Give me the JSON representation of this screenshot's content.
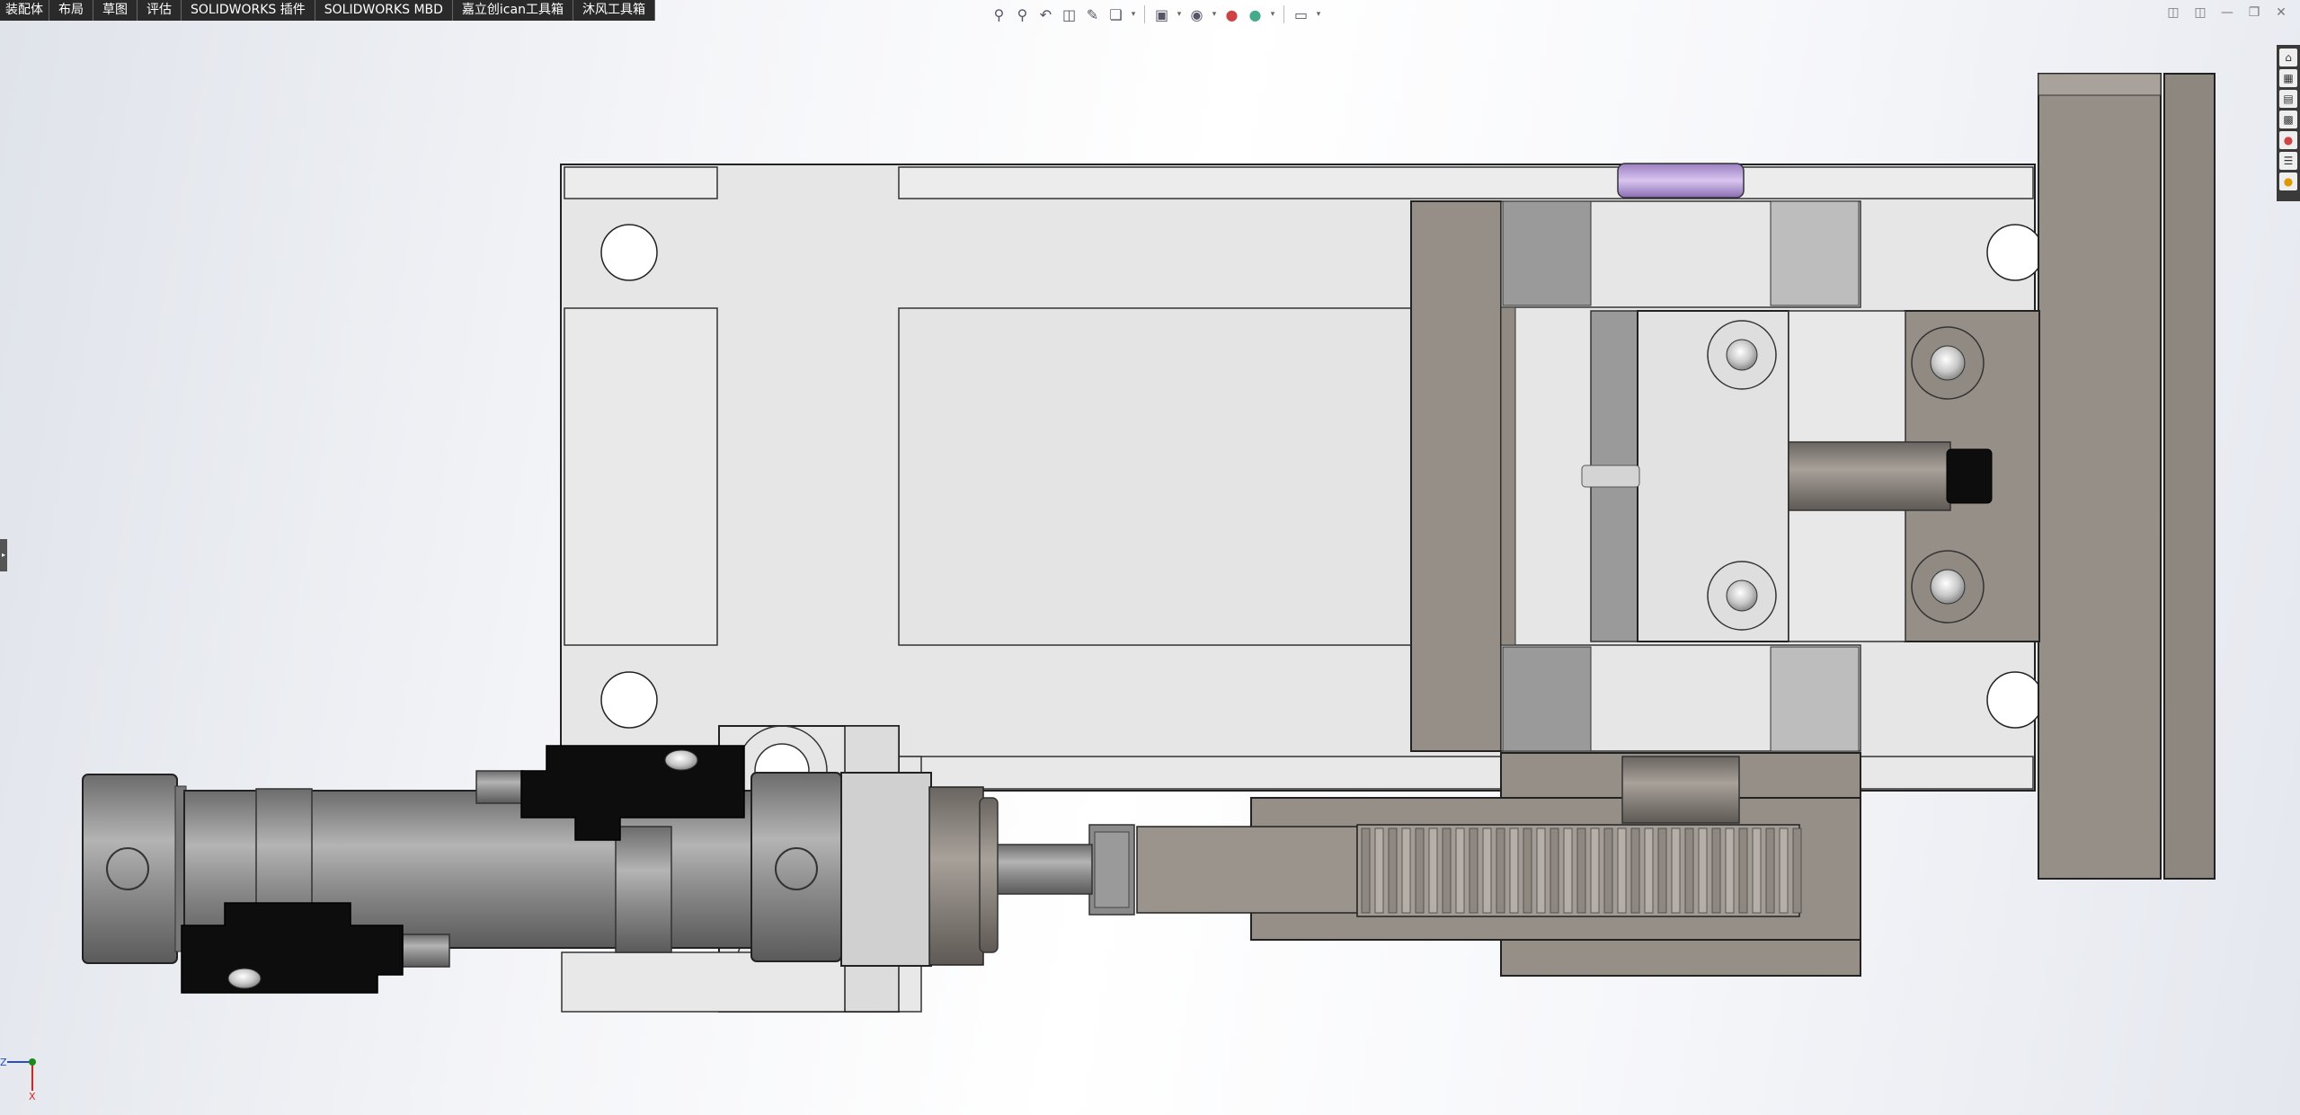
{
  "ribbon_tabs": [
    "装配体",
    "布局",
    "草图",
    "评估",
    "SOLIDWORKS 插件",
    "SOLIDWORKS MBD",
    "嘉立创ican工具箱",
    "沐风工具箱"
  ],
  "headsup_icons": [
    "zoom-to-fit-icon",
    "zoom-to-area-icon",
    "previous-view-icon",
    "section-view-icon",
    "dynamic-annotation-icon",
    "view-orientation-icon",
    "display-style-icon",
    "hide-show-items-icon",
    "edit-appearance-icon",
    "apply-scene-icon",
    "view-settings-icon"
  ],
  "window_controls": [
    "tile-left-icon",
    "tile-right-icon",
    "minimize-icon",
    "restore-icon",
    "close-icon"
  ],
  "task_pane_icons": [
    "solidworks-resources-icon",
    "design-library-icon",
    "file-explorer-icon",
    "view-palette-icon",
    "appearances-icon",
    "custom-properties-icon",
    "solidworks-forum-icon"
  ],
  "triad": {
    "z_label": "Z",
    "x_label": "X"
  },
  "colors": {
    "ribbon_bg": "#2a2a2a",
    "plate": "#e6e6e6",
    "bronze": "#958f87",
    "steel": "#8a8a8a",
    "sensor": "#0d0d0d",
    "purple": "#b59bd6"
  }
}
